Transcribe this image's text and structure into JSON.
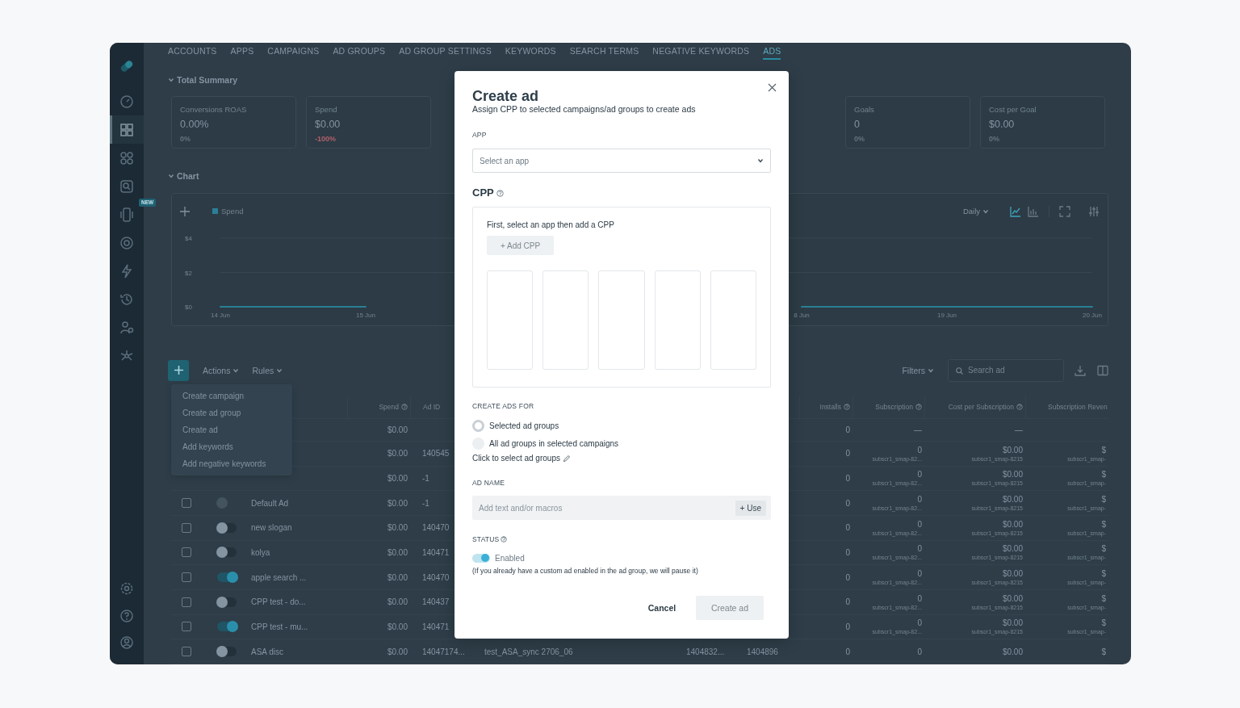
{
  "sidebar": {
    "items": [
      {
        "selected": false
      },
      {
        "selected": true
      },
      {
        "selected": false
      },
      {
        "selected": false
      },
      {
        "selected": false,
        "badge": "NEW"
      },
      {
        "selected": false
      },
      {
        "selected": false
      },
      {
        "selected": false
      },
      {
        "selected": false
      },
      {
        "selected": false
      }
    ],
    "bottom_items": [
      {
        "selected": false
      },
      {
        "selected": false
      },
      {
        "selected": false
      }
    ]
  },
  "nav": {
    "tabs": [
      {
        "label": "ACCOUNTS",
        "selected": false
      },
      {
        "label": "APPS",
        "selected": false
      },
      {
        "label": "CAMPAIGNS",
        "selected": false
      },
      {
        "label": "AD GROUPS",
        "selected": false
      },
      {
        "label": "AD GROUP SETTINGS",
        "selected": false
      },
      {
        "label": "KEYWORDS",
        "selected": false
      },
      {
        "label": "SEARCH TERMS",
        "selected": false
      },
      {
        "label": "NEGATIVE KEYWORDS",
        "selected": false
      },
      {
        "label": "ADS",
        "selected": true
      }
    ]
  },
  "summary": {
    "title": "Total Summary",
    "expanded": true,
    "left_cards": [
      {
        "label": "Conversions ROAS",
        "value": "0.00%",
        "change": "0%",
        "color": "#64737d"
      },
      {
        "label": "Spend",
        "value": "$0.00",
        "change": "-100%",
        "color": "#b0606c"
      }
    ],
    "right_cards": [
      {
        "label": "Goals",
        "value": "0",
        "change": "0%",
        "color": "#64737d"
      },
      {
        "label": "Cost per Goal",
        "value": "$0.00",
        "change": "0%",
        "color": "#64737d"
      }
    ]
  },
  "chart": {
    "title": "Chart",
    "expanded": true,
    "interval": "Daily",
    "view_buttons": [
      {
        "kind": "line",
        "selected": true
      },
      {
        "kind": "bar",
        "selected": false
      }
    ],
    "chart_data": {
      "type": "line",
      "categories": [
        "14 Jun",
        "15 Jun",
        null,
        null,
        "8 Jun",
        "19 Jun",
        "20 Jun"
      ],
      "ylim": [
        0,
        4
      ],
      "yticks": [
        {
          "value": 0,
          "label": "$0"
        },
        {
          "value": 2,
          "label": "$2"
        },
        {
          "value": 4,
          "label": "$4"
        }
      ],
      "series": [
        {
          "name": "Spend",
          "color": "#2a7f96",
          "values": [
            0,
            0,
            null,
            null,
            0,
            0,
            0
          ]
        }
      ]
    }
  },
  "toolbar": {
    "actions": "Actions",
    "rules": "Rules",
    "filters": "Filters",
    "search_placeholder": "Search ad"
  },
  "actions_menu": {
    "open": true,
    "items": [
      "Create campaign",
      "Create ad group",
      "Create ad",
      "Add keywords",
      "Add negative keywords"
    ]
  },
  "table": {
    "columns": [
      {
        "label": "Spend",
        "info": true
      },
      {
        "label": "Ad ID",
        "info": false
      },
      {
        "label": "Installs",
        "info": true
      },
      {
        "label": "Subscription",
        "info": true
      },
      {
        "label": "Cost per Subscription",
        "info": true
      },
      {
        "label": "Subscription Reven",
        "info": false
      }
    ],
    "totals": {
      "spend": "$0.00",
      "installs": "0",
      "subscription": "—",
      "cost_per_subscription": "—"
    },
    "rows": [
      {
        "cells": [
          {
            "text": "$0.00"
          },
          {
            "text": "140545"
          },
          {
            "text": "0"
          },
          {
            "text": "0",
            "sub": "subscr1_smap-82..."
          },
          {
            "text": "$0.00",
            "sub": "subscr1_smap-8215"
          },
          {
            "text": "$",
            "sub": "subscr1_smap-"
          }
        ]
      },
      {
        "cells": [
          {
            "text": "$0.00"
          },
          {
            "text": "-1"
          },
          {
            "text": "0"
          },
          {
            "text": "0",
            "sub": "subscr1_smap-82..."
          },
          {
            "text": "$0.00",
            "sub": "subscr1_smap-8215"
          },
          {
            "text": "$",
            "sub": "subscr1_smap-"
          }
        ]
      },
      {
        "checked": false,
        "enabled": false,
        "disabled": true,
        "name": "Default Ad",
        "cells": [
          {
            "text": "$0.00"
          },
          {
            "text": "-1"
          },
          {
            "text": "0"
          },
          {
            "text": "0",
            "sub": "subscr1_smap-82..."
          },
          {
            "text": "$0.00",
            "sub": "subscr1_smap-8215"
          },
          {
            "text": "$",
            "sub": "subscr1_smap-"
          }
        ]
      },
      {
        "checked": false,
        "enabled": false,
        "disabled": false,
        "name": "new slogan",
        "cells": [
          {
            "text": "$0.00"
          },
          {
            "text": "140470"
          },
          {
            "text": "0"
          },
          {
            "text": "0",
            "sub": "subscr1_smap-82..."
          },
          {
            "text": "$0.00",
            "sub": "subscr1_smap-8215"
          },
          {
            "text": "$",
            "sub": "subscr1_smap-"
          }
        ]
      },
      {
        "checked": false,
        "enabled": false,
        "disabled": false,
        "name": "kolya",
        "cells": [
          {
            "text": "$0.00"
          },
          {
            "text": "140471"
          },
          {
            "text": "0"
          },
          {
            "text": "0",
            "sub": "subscr1_smap-82..."
          },
          {
            "text": "$0.00",
            "sub": "subscr1_smap-8215"
          },
          {
            "text": "$",
            "sub": "subscr1_smap-"
          }
        ]
      },
      {
        "checked": false,
        "enabled": true,
        "disabled": false,
        "name": "apple search ...",
        "cells": [
          {
            "text": "$0.00"
          },
          {
            "text": "140470"
          },
          {
            "text": "0"
          },
          {
            "text": "0",
            "sub": "subscr1_smap-82..."
          },
          {
            "text": "$0.00",
            "sub": "subscr1_smap-8215"
          },
          {
            "text": "$",
            "sub": "subscr1_smap-"
          }
        ]
      },
      {
        "checked": false,
        "enabled": false,
        "disabled": false,
        "name": "CPP test - do...",
        "cells": [
          {
            "text": "$0.00"
          },
          {
            "text": "140437"
          },
          {
            "text": "0"
          },
          {
            "text": "0",
            "sub": "subscr1_smap-82..."
          },
          {
            "text": "$0.00",
            "sub": "subscr1_smap-8215"
          },
          {
            "text": "$",
            "sub": "subscr1_smap-"
          }
        ]
      },
      {
        "checked": false,
        "enabled": true,
        "disabled": false,
        "name": "CPP test - mu...",
        "cells": [
          {
            "text": "$0.00"
          },
          {
            "text": "140471"
          },
          {
            "text": "0"
          },
          {
            "text": "0",
            "sub": "subscr1_smap-82..."
          },
          {
            "text": "$0.00",
            "sub": "subscr1_smap-8215"
          },
          {
            "text": "$",
            "sub": "subscr1_smap-"
          }
        ]
      },
      {
        "checked": false,
        "enabled": false,
        "disabled": false,
        "name": "ASA disc",
        "middle_cells": [
          "test_ASA_sync 2706_06",
          "1404832...",
          "1404896"
        ],
        "cells": [
          {
            "text": "$0.00"
          },
          {
            "text": "14047174..."
          },
          {
            "text": "0"
          },
          {
            "text": "0"
          },
          {
            "text": "$0.00"
          },
          {
            "text": "$"
          }
        ]
      }
    ]
  },
  "modal": {
    "title": "Create ad",
    "subtitle": "Assign CPP to selected campaigns/ad groups to create ads",
    "app": {
      "label": "APP",
      "placeholder": "Select an app"
    },
    "cpp": {
      "title": "CPP",
      "hint": "First, select an app then add a CPP",
      "add_button": "+ Add CPP",
      "add_disabled": true,
      "placeholders": [
        {
          "kind": "empty"
        },
        {
          "kind": "empty"
        },
        {
          "kind": "empty"
        },
        {
          "kind": "empty"
        },
        {
          "kind": "empty"
        }
      ]
    },
    "create_for": {
      "label": "CREATE ADS FOR",
      "options": [
        {
          "label": "Selected ad groups",
          "selected": true
        },
        {
          "label": "All ad groups in selected campaigns",
          "selected": false
        }
      ],
      "link": "Click to select ad groups"
    },
    "ad_name": {
      "label": "AD NAME",
      "placeholder": "Add text and/or macros",
      "use_button": "+ Use"
    },
    "status": {
      "label": "STATUS",
      "on": true,
      "value": "Enabled",
      "note": "(If you already have a custom ad enabled in the ad group, we will pause it)"
    },
    "buttons": [
      {
        "label": "Cancel",
        "kind": "secondary",
        "disabled": false
      },
      {
        "label": "Create ad",
        "kind": "primary",
        "disabled": true
      }
    ]
  }
}
